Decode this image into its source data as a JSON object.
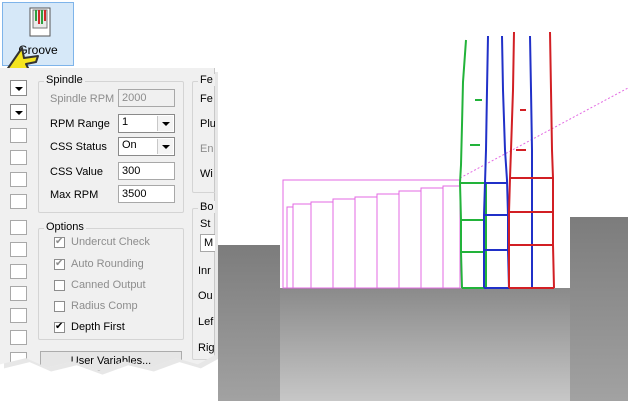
{
  "toolbar": {
    "groove_label": "Groove"
  },
  "spindle": {
    "title": "Spindle",
    "rpm_label": "Spindle RPM",
    "rpm_value": "2000",
    "rpm_range_label": "RPM Range",
    "rpm_range_value": "1",
    "css_status_label": "CSS Status",
    "css_status_value": "On",
    "css_value_label": "CSS Value",
    "css_value": "300",
    "max_rpm_label": "Max RPM",
    "max_rpm_value": "3500"
  },
  "options": {
    "title": "Options",
    "items": [
      {
        "label": "Undercut Check",
        "checked": true,
        "enabled": false
      },
      {
        "label": "Auto Rounding",
        "checked": true,
        "enabled": false
      },
      {
        "label": "Canned Output",
        "checked": false,
        "enabled": false
      },
      {
        "label": "Radius Comp",
        "checked": false,
        "enabled": false
      },
      {
        "label": "Depth First",
        "checked": true,
        "enabled": true
      }
    ]
  },
  "user_variables_button": "User Variables...",
  "right_col": {
    "fe1": "Fe",
    "fe2": "Fe",
    "plu": "Plu",
    "en": "En",
    "wi": "Wi",
    "bo": "Bo",
    "st": "St",
    "m": "M",
    "inr": "Inr",
    "ou": "Ou",
    "lef": "Lef",
    "rig": "Rig"
  },
  "colors": {
    "highlight_border": "#c0262c",
    "highlight_fill": "#f2f2c4",
    "toolpath_pink": "#e36ae3"
  }
}
